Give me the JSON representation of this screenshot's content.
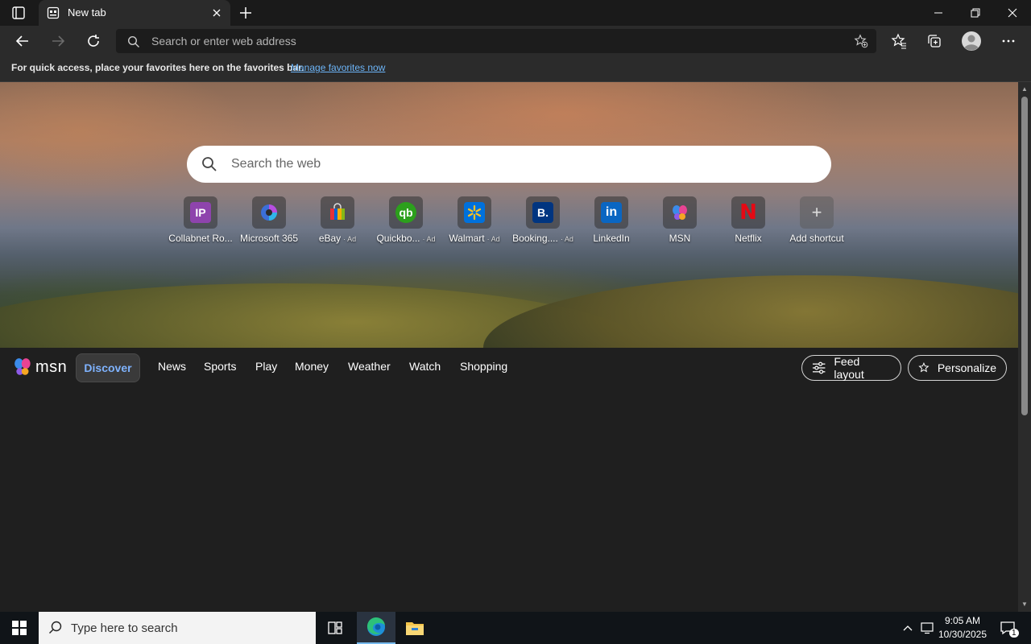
{
  "browser": {
    "tab": {
      "title": "New tab"
    },
    "address_bar": {
      "placeholder": "Search or enter web address"
    },
    "favorites_bar": {
      "message": "For quick access, place your favorites here on the favorites bar.",
      "link": "Manage favorites now"
    }
  },
  "newtab": {
    "search_placeholder": "Search the web",
    "shortcuts": [
      {
        "label": "Collabnet Ro...",
        "ad": "",
        "icon": "collabnet-icon",
        "color": "#8e44ad"
      },
      {
        "label": "Microsoft 365",
        "ad": "",
        "icon": "microsoft365-icon",
        "color": "#3b6fd8"
      },
      {
        "label": "eBay",
        "ad": "· Ad",
        "icon": "ebay-bag-icon",
        "color": "#333333"
      },
      {
        "label": "Quickbo...",
        "ad": "· Ad",
        "icon": "quickbooks-icon",
        "color": "#2ca01c"
      },
      {
        "label": "Walmart",
        "ad": "· Ad",
        "icon": "walmart-icon",
        "color": "#0071dc"
      },
      {
        "label": "Booking....",
        "ad": "· Ad",
        "icon": "booking-icon",
        "color": "#003580"
      },
      {
        "label": "LinkedIn",
        "ad": "",
        "icon": "linkedin-icon",
        "color": "#0a66c2"
      },
      {
        "label": "MSN",
        "ad": "",
        "icon": "msn-butterfly-icon",
        "color": "#333333"
      },
      {
        "label": "Netflix",
        "ad": "",
        "icon": "netflix-icon",
        "color": "#333333"
      },
      {
        "label": "Add shortcut",
        "ad": "",
        "icon": "plus-icon",
        "color": "#555555"
      }
    ],
    "shortcut_logos": [
      "IP",
      "",
      "",
      "qb",
      "",
      "B.",
      "in",
      "",
      "N",
      "+"
    ],
    "msn": {
      "logo_text": "msn",
      "nav": [
        "Discover",
        "News",
        "Sports",
        "Play",
        "Money",
        "Weather",
        "Watch",
        "Shopping"
      ],
      "feed_layout": "Feed layout",
      "personalize": "Personalize"
    }
  },
  "taskbar": {
    "search_placeholder": "Type here to search",
    "time": "9:05 AM",
    "date": "10/30/2025",
    "notification_count": "1"
  }
}
